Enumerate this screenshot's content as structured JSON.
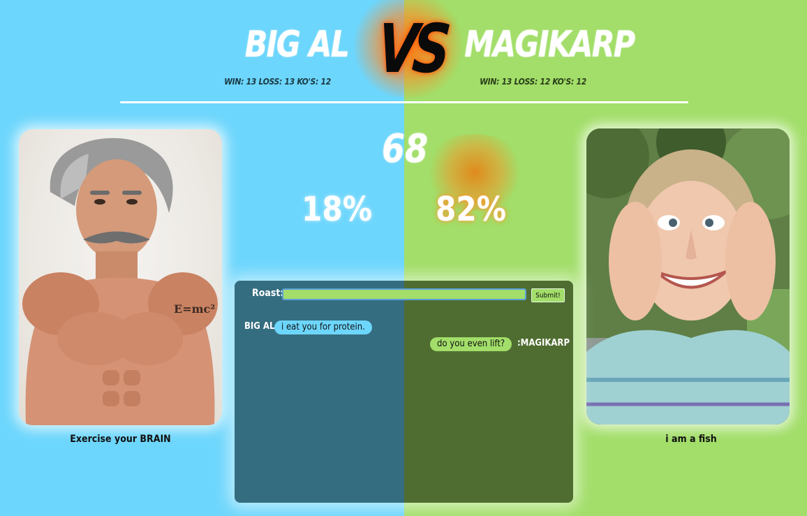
{
  "left_fighter": {
    "name": "BIG AL",
    "stats": "WIN: 13 LOSS: 13 KO'S: 12",
    "caption": "Exercise your BRAIN",
    "percent": "18%",
    "color": "#6dd6fc"
  },
  "right_fighter": {
    "name": "MAGIKARP",
    "stats": "WIN: 13 LOSS: 12 KO'S: 12",
    "caption": "i am a fish",
    "percent": "82%",
    "color": "#a2de69"
  },
  "versus": "VS",
  "score": "68",
  "roast": {
    "label": "Roast:",
    "input_value": "",
    "submit_label": "Submit!"
  },
  "messages": [
    {
      "name": "BIG AL:",
      "text": "i eat you for protein.",
      "side": "left"
    },
    {
      "name": ":MAGIKARP",
      "text": "do you even lift?",
      "side": "right"
    }
  ]
}
